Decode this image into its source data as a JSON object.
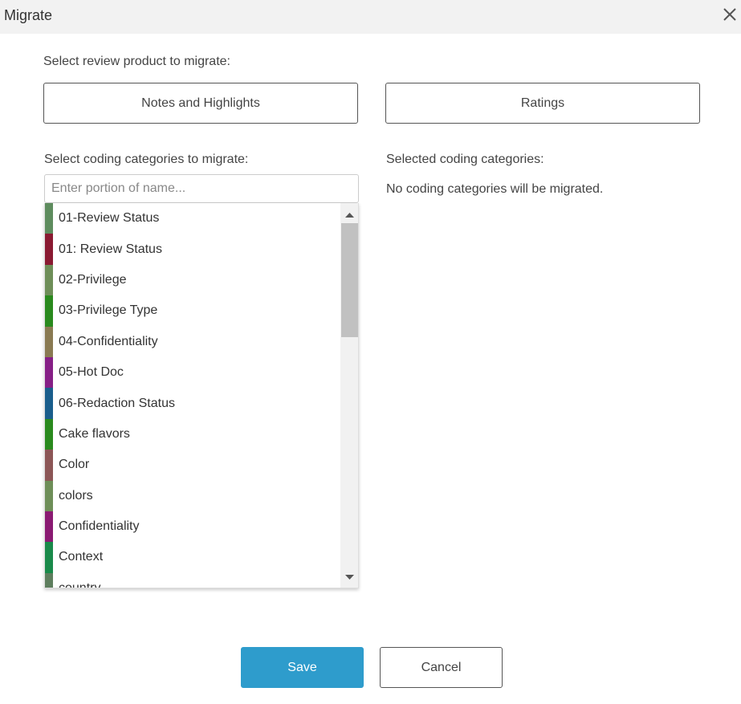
{
  "dialog": {
    "title": "Migrate",
    "close_icon": "close-icon"
  },
  "product": {
    "label": "Select review product to migrate:",
    "options": [
      {
        "label": "Notes and Highlights"
      },
      {
        "label": "Ratings"
      }
    ]
  },
  "categories": {
    "label": "Select coding categories to migrate:",
    "search_placeholder": "Enter portion of name...",
    "items": [
      {
        "label": "01-Review Status",
        "color": "#5e8c5e"
      },
      {
        "label": "01: Review Status",
        "color": "#8a1a32"
      },
      {
        "label": "02-Privilege",
        "color": "#6e8e58"
      },
      {
        "label": "03-Privilege Type",
        "color": "#2a8a1e"
      },
      {
        "label": "04-Confidentiality",
        "color": "#8a7a52"
      },
      {
        "label": "05-Hot Doc",
        "color": "#861f86"
      },
      {
        "label": "06-Redaction Status",
        "color": "#1a5e8c"
      },
      {
        "label": "Cake flavors",
        "color": "#2a8a1e"
      },
      {
        "label": "Color",
        "color": "#8c5656"
      },
      {
        "label": "colors",
        "color": "#6e8e58"
      },
      {
        "label": "Confidentiality",
        "color": "#8a1a72"
      },
      {
        "label": "Context",
        "color": "#1a8a4a"
      },
      {
        "label": "country",
        "color": "#5e7e5e"
      }
    ],
    "scroll_up_icon": "triangle-up-icon",
    "scroll_down_icon": "triangle-down-icon"
  },
  "selected": {
    "label": "Selected coding categories:",
    "empty_text": "No coding categories will be migrated."
  },
  "footer": {
    "save_label": "Save",
    "cancel_label": "Cancel"
  },
  "colors": {
    "primary": "#2e9ccc",
    "header_bg": "#f2f2f2"
  }
}
